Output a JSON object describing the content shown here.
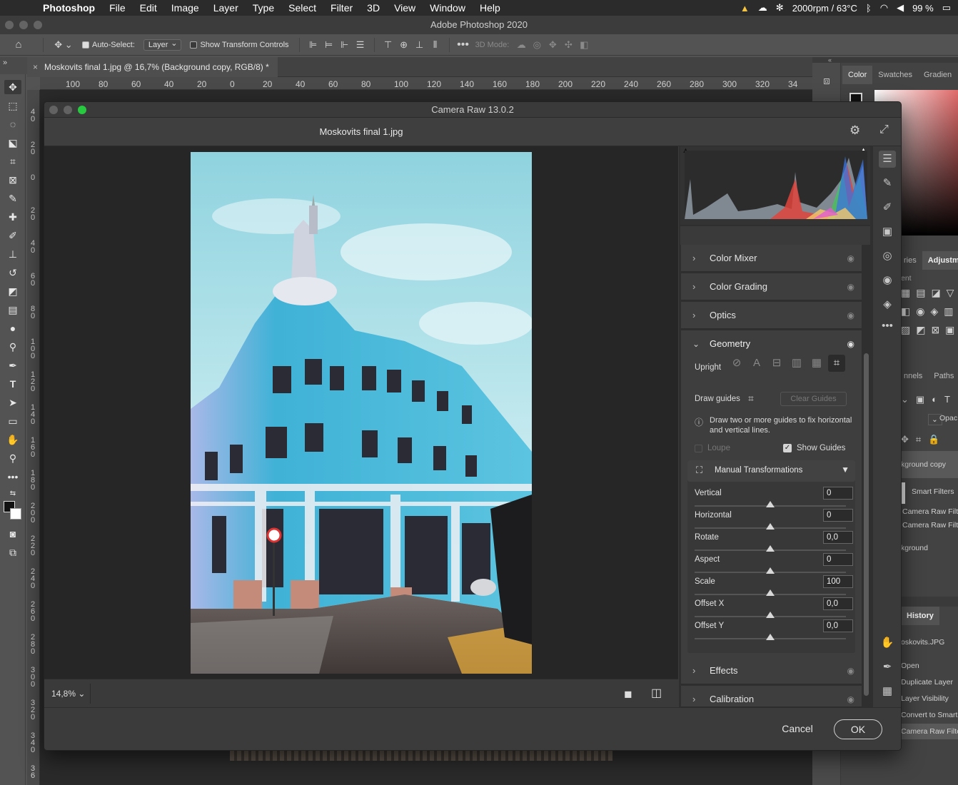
{
  "menubar": {
    "app": "Photoshop",
    "items": [
      "File",
      "Edit",
      "Image",
      "Layer",
      "Type",
      "Select",
      "Filter",
      "3D",
      "View",
      "Window",
      "Help"
    ],
    "status": {
      "fan": "2000rpm / 63°C",
      "battery": "99 %"
    }
  },
  "window_title": "Adobe Photoshop 2020",
  "options_bar": {
    "auto_select_label": "Auto-Select:",
    "auto_select_value": "Layer",
    "show_transform_label": "Show Transform Controls",
    "mode_3d_label": "3D Mode:"
  },
  "document_tab": "Moskovits final 1.jpg @ 16,7% (Background copy, RGB/8) *",
  "ruler_h": [
    "100",
    "80",
    "60",
    "40",
    "20",
    "0",
    "20",
    "40",
    "60",
    "80",
    "100",
    "120",
    "140",
    "160",
    "180",
    "200",
    "220",
    "240",
    "260",
    "280",
    "300",
    "320",
    "34"
  ],
  "ruler_v": [
    "40",
    "20",
    "0",
    "20",
    "40",
    "60",
    "80",
    "100",
    "120",
    "140",
    "160",
    "180",
    "200",
    "220",
    "240",
    "260",
    "280",
    "300",
    "320",
    "340",
    "36"
  ],
  "ps_panels": {
    "color_tabs": [
      "Color",
      "Swatches",
      "Gradien"
    ],
    "adj_tabs": [
      "ries",
      "Adjustm"
    ],
    "adj_label": "ent",
    "layer_tabs": [
      "nnels",
      "Paths"
    ],
    "opacity": "Opac",
    "layers": [
      "kground copy",
      "Smart Filters",
      "Camera Raw Filt",
      "Camera Raw Filt",
      "kground"
    ],
    "history_tab": "History",
    "history_items": [
      "oskovits.JPG",
      "Open",
      "Duplicate Layer",
      "Layer Visibility",
      "Convert to Smart",
      "Camera Raw Filte"
    ]
  },
  "camera_raw": {
    "title": "Camera Raw 13.0.2",
    "filename": "Moskovits final 1.jpg",
    "zoom": "14,8%",
    "sections": {
      "color_mixer": "Color Mixer",
      "color_grading": "Color Grading",
      "optics": "Optics",
      "geometry": "Geometry",
      "effects": "Effects",
      "calibration": "Calibration"
    },
    "geometry": {
      "upright_label": "Upright",
      "draw_guides_label": "Draw guides",
      "clear_guides": "Clear Guides",
      "info": "Draw two or more guides to fix horizontal and vertical lines.",
      "loupe": "Loupe",
      "show_guides": "Show Guides",
      "manual_title": "Manual Transformations",
      "sliders": [
        {
          "name": "Vertical",
          "value": "0",
          "pos": 0.5
        },
        {
          "name": "Horizontal",
          "value": "0",
          "pos": 0.5
        },
        {
          "name": "Rotate",
          "value": "0,0",
          "pos": 0.5
        },
        {
          "name": "Aspect",
          "value": "0",
          "pos": 0.5
        },
        {
          "name": "Scale",
          "value": "100",
          "pos": 0.5
        },
        {
          "name": "Offset X",
          "value": "0,0",
          "pos": 0.5
        },
        {
          "name": "Offset Y",
          "value": "0,0",
          "pos": 0.5
        }
      ]
    },
    "cancel": "Cancel",
    "ok": "OK"
  }
}
